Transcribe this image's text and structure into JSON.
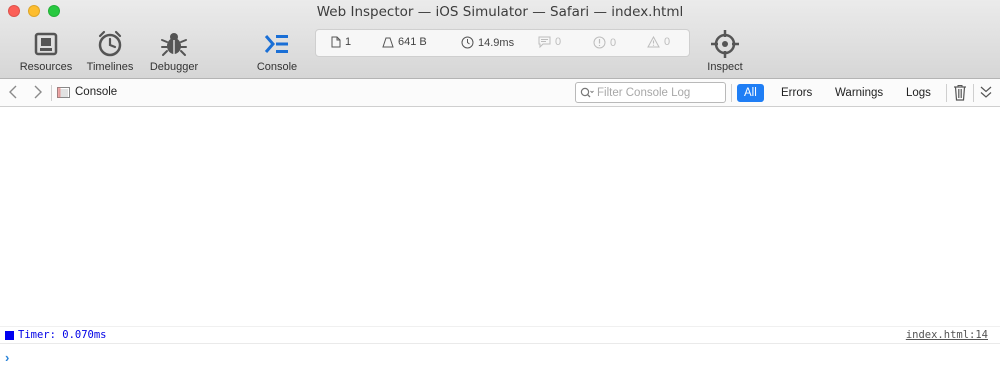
{
  "window": {
    "title": "Web Inspector — iOS Simulator — Safari — index.html"
  },
  "toolbar": {
    "resources_label": "Resources",
    "timelines_label": "Timelines",
    "debugger_label": "Debugger",
    "console_label": "Console",
    "inspect_label": "Inspect"
  },
  "dashboard": {
    "resources_count": "1",
    "resources_size": "641 B",
    "load_time": "14.9ms",
    "logs_count": "0",
    "errors_count": "0",
    "warnings_count": "0"
  },
  "navbar": {
    "breadcrumb": "Console",
    "filter_placeholder": "Filter Console Log",
    "scopes": [
      "All",
      "Errors",
      "Warnings",
      "Logs"
    ]
  },
  "console": {
    "messages": [
      {
        "text": "Timer: 0.070ms",
        "source": "index.html:14"
      }
    ],
    "prompt_symbol": "›"
  },
  "colors": {
    "accent": "#1f7ef5",
    "console_blue": "#1a6fd6",
    "message_blue": "#0000e6"
  }
}
